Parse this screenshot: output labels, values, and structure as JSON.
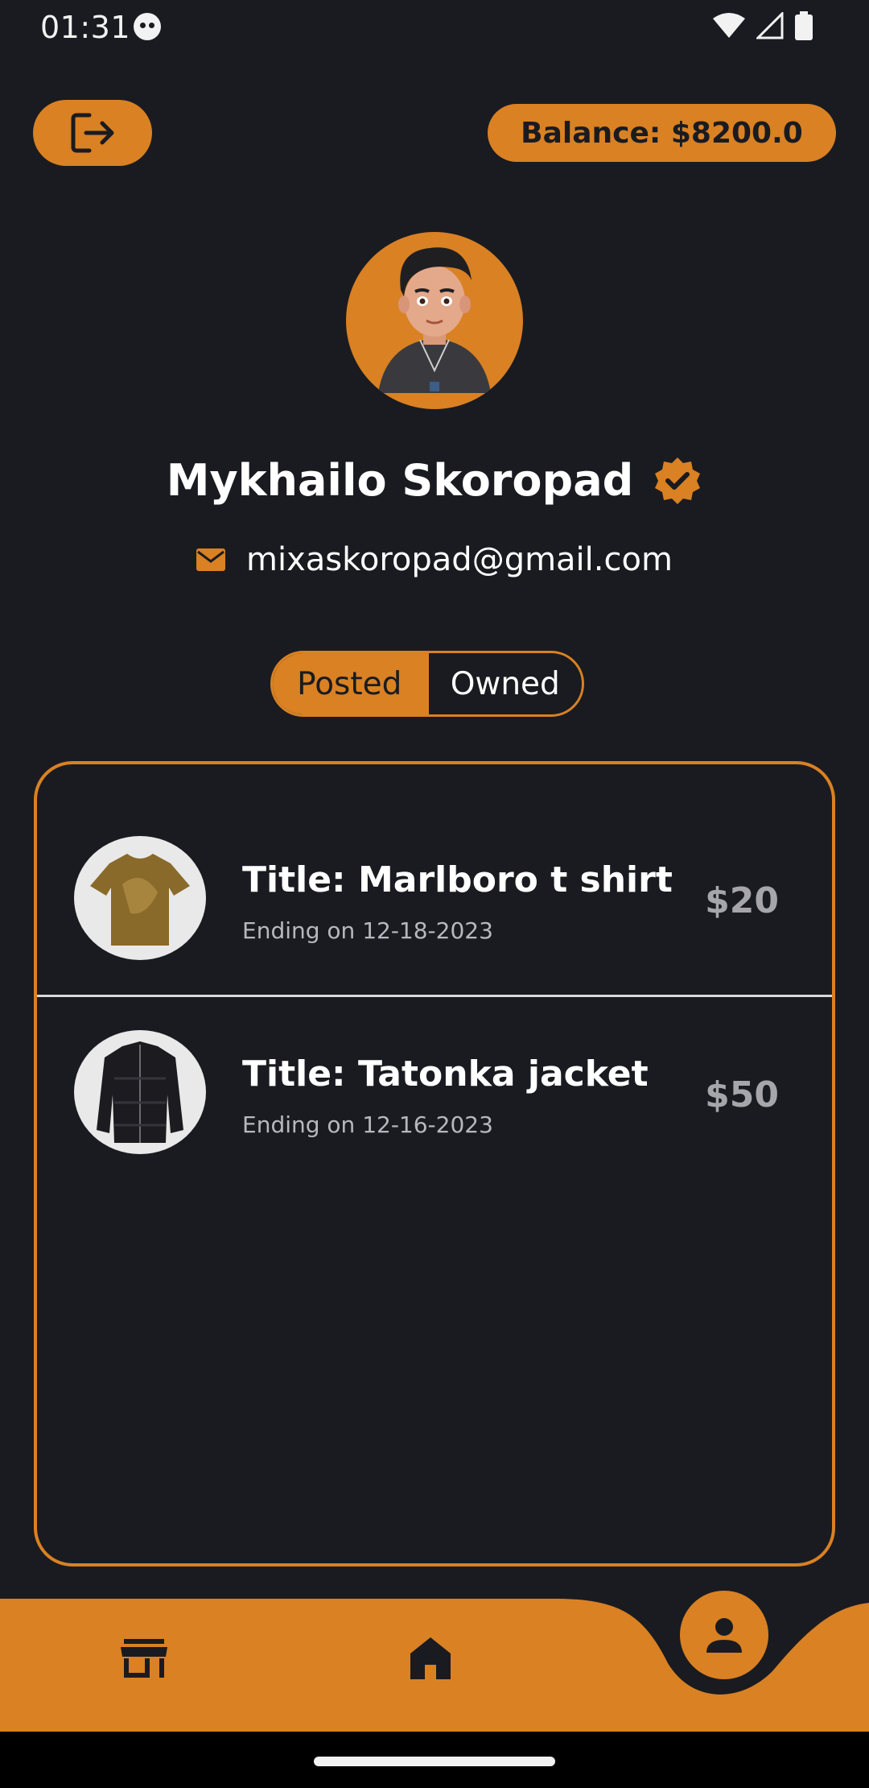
{
  "status_bar": {
    "time": "01:31"
  },
  "header": {
    "balance_text": "Balance: $8200.0"
  },
  "profile": {
    "name": "Mykhailo Skoropad",
    "email": "mixaskoropad@gmail.com"
  },
  "tabs": {
    "posted_label": "Posted",
    "owned_label": "Owned",
    "selected": "Posted"
  },
  "items": [
    {
      "title": "Title: Marlboro t shirt",
      "ending": "Ending on 12-18-2023",
      "price": "$20"
    },
    {
      "title": "Title: Tatonka jacket",
      "ending": "Ending on 12-16-2023",
      "price": "$50"
    }
  ],
  "colors": {
    "accent": "#d98123",
    "background": "#1a1b20",
    "price_gray": "#a6a6aa"
  },
  "nav": {
    "items": [
      "store-icon",
      "home-icon",
      "person-icon"
    ],
    "active": "person-icon"
  }
}
